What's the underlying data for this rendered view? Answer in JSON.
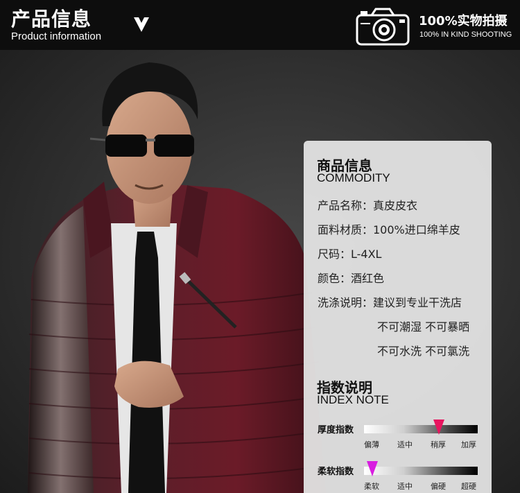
{
  "header": {
    "title_cn": "产品信息",
    "title_en": "Product information",
    "shoot_cn": "100%实物拍摄",
    "shoot_en": "100% IN KIND SHOOTING"
  },
  "commodity": {
    "heading_cn": "商品信息",
    "heading_en": "COMMODITY",
    "rows": [
      "产品名称：真皮皮衣",
      "面料材质：100%进口绵羊皮",
      "尺码：L-4XL",
      "颜色：酒红色",
      "洗涤说明：建议到专业干洗店",
      "不可潮湿 不可暴晒",
      "不可水洗 不可氯洗"
    ]
  },
  "index_note": {
    "heading_cn": "指数说明",
    "heading_en": "INDEX NOTE",
    "scales": [
      {
        "label": "厚度指数",
        "ticks": [
          "偏薄",
          "适中",
          "稍厚",
          "加厚"
        ],
        "selected_index": 2,
        "marker_color": "#e8155f"
      },
      {
        "label": "柔软指数",
        "ticks": [
          "柔软",
          "适中",
          "偏硬",
          "超硬"
        ],
        "selected_index": 0,
        "marker_color": "#d81ee0"
      }
    ]
  },
  "icons": [
    "down-arrow-icon",
    "camera-icon"
  ]
}
